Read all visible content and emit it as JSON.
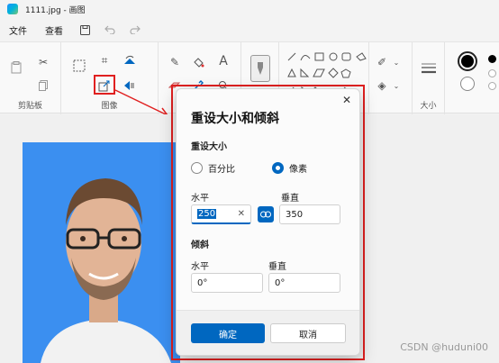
{
  "window": {
    "title": "1111.jpg - 画图"
  },
  "menu": {
    "file": "文件",
    "view": "查看"
  },
  "ribbon": {
    "clipboard_label": "剪贴板",
    "image_label": "图像",
    "size_label": "大小"
  },
  "dialog": {
    "title": "重设大小和倾斜",
    "resize_section": "重设大小",
    "option_percent": "百分比",
    "option_pixels": "像素",
    "selected_option": "像素",
    "horizontal_label": "水平",
    "vertical_label": "垂直",
    "horizontal_value": "250",
    "vertical_value": "350",
    "skew_section": "倾斜",
    "skew_horizontal_label": "水平",
    "skew_vertical_label": "垂直",
    "skew_horizontal_value": "0°",
    "skew_vertical_value": "0°",
    "ok": "确定",
    "cancel": "取消"
  },
  "watermark": "CSDN @huduni00",
  "colors": {
    "accent": "#0067c0",
    "highlight": "#e02020",
    "photo_bg": "#3b8ff0"
  }
}
